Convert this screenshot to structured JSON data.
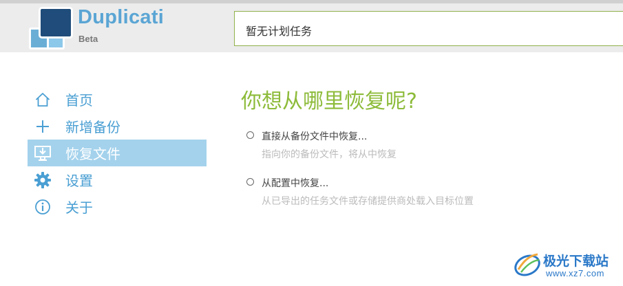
{
  "app": {
    "name": "Duplicati",
    "channel": "Beta",
    "accent_color": "#5aa5d4",
    "logo_dark_color": "#1f4c7a"
  },
  "status": {
    "text": "暂无计划任务",
    "border_color": "#8fb04a"
  },
  "nav": {
    "items": [
      {
        "label": "首页",
        "icon": "home-icon",
        "active": false
      },
      {
        "label": "新增备份",
        "icon": "plus-icon",
        "active": false
      },
      {
        "label": "恢复文件",
        "icon": "restore-icon",
        "active": true
      },
      {
        "label": "设置",
        "icon": "gear-icon",
        "active": false
      },
      {
        "label": "关于",
        "icon": "info-icon",
        "active": false
      }
    ],
    "active_bg_color": "#a4d2ec"
  },
  "restore": {
    "title": "你想从哪里恢复呢?",
    "title_color": "#8dbb3a",
    "options": [
      {
        "label": "直接从备份文件中恢复...",
        "description": "指向你的备份文件，将从中恢复",
        "selected": false
      },
      {
        "label": "从配置中恢复...",
        "description": "从已导出的任务文件或存储提供商处载入目标位置",
        "selected": false
      }
    ]
  },
  "watermark": {
    "name": "极光下载站",
    "url": "www.xz7.com",
    "logo_icon": "aurora-logo-icon"
  }
}
